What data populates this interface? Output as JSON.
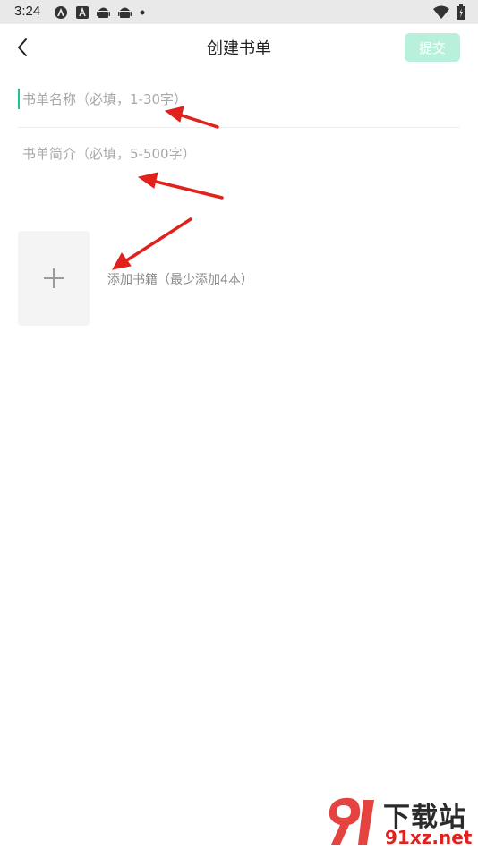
{
  "status_bar": {
    "time": "3:24",
    "icons": [
      "circle-a-icon",
      "a-box-icon",
      "android-icon",
      "android-icon",
      "dot-icon",
      "wifi-icon",
      "battery-icon"
    ]
  },
  "header": {
    "title": "创建书单",
    "submit_label": "提交",
    "back_icon": "chevron-left-icon"
  },
  "form": {
    "name_placeholder": "书单名称（必填，1-30字）",
    "name_value": "",
    "intro_placeholder": "书单简介（必填，5-500字）",
    "intro_value": "",
    "add_books_label": "添加书籍（最少添加4本）",
    "add_icon": "plus-icon"
  },
  "watermark": {
    "text_top": "下载站",
    "text_bottom": "91xz.net"
  },
  "colors": {
    "accent": "#20c58c",
    "submit_disabled_bg": "#b9f0dc",
    "placeholder": "#a9a9a9",
    "annotation_arrow": "#e0211c"
  }
}
